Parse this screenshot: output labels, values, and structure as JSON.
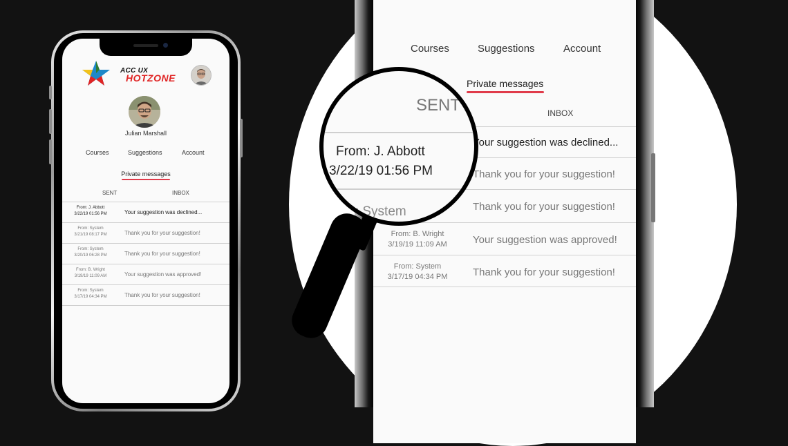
{
  "app": {
    "brand_line1": "ACC UX",
    "brand_line2": "HOTZONE",
    "user_name": "Julian Marshall"
  },
  "nav": {
    "courses": "Courses",
    "suggestions": "Suggestions",
    "account": "Account"
  },
  "section_title": "Private messages",
  "tabs": {
    "sent": "SENT",
    "inbox": "INBOX"
  },
  "messages": [
    {
      "from": "From: J. Abbott",
      "time": "3/22/19 01:56 PM",
      "text": "Your suggestion was declined...",
      "unread": true
    },
    {
      "from": "From: System",
      "time": "3/21/19 08:17 PM",
      "text": "Thank you for your suggestion!",
      "unread": false
    },
    {
      "from": "From: System",
      "time": "3/20/19 06:28 PM",
      "text": "Thank you for your suggestion!",
      "unread": false
    },
    {
      "from": "From: B. Wright",
      "time": "3/19/19 11:09 AM",
      "text": "Your suggestion was approved!",
      "unread": false
    },
    {
      "from": "From: System",
      "time": "3/17/19 04:34 PM",
      "text": "Thank you for your suggestion!",
      "unread": false
    }
  ],
  "zoom": {
    "row1_text": "Your suggestion was declined...",
    "row2_text": "Thank you for your suggestion!",
    "row3_text": "Thank you for your suggestion!",
    "row4_from": "From: B. Wright",
    "row4_time": "3/19/19 11:09 AM",
    "row4_text": "Your suggestion was approved!",
    "row5_from": "From: System",
    "row5_time": "3/17/19 04:34 PM",
    "row5_text": "Thank you for your suggestion!",
    "row3_time_fragment": "M"
  },
  "lens": {
    "sent": "SENT",
    "from": "From: J. Abbott",
    "time": "3/22/19 01:56 PM",
    "system_fragment": "m: System"
  },
  "colors": {
    "accent_red": "#e03b4a",
    "background": "#121212",
    "screen": "#fafafa"
  }
}
